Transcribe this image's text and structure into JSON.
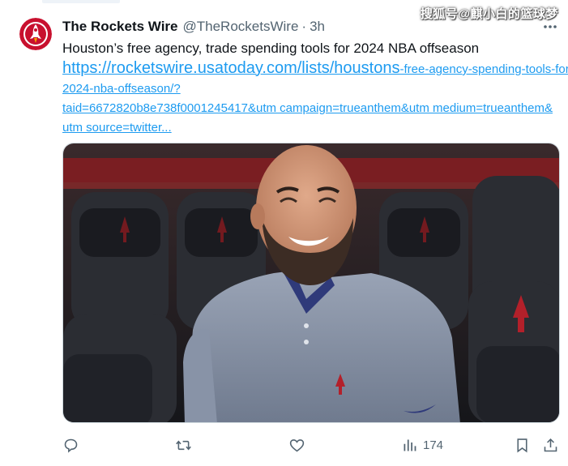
{
  "tweet": {
    "display_name": "The Rockets Wire",
    "handle": "@TheRocketsWire",
    "separator": "·",
    "time": "3h",
    "text": "Houston’s free agency, trade spending tools for 2024 NBA offseason",
    "link_line1_big": "https://rocketswire.usatoday.com/lists/houstons",
    "link_line1_rest": "-free-agency-spending-tools-for-",
    "link_line2": "2024-nba-offseason/?",
    "link_line3": "taid=6672820b8e738f0001245417&utm campaign=trueanthem&utm medium=trueanthem&",
    "link_line4": "utm source=twitter..."
  },
  "watermark": "搜狐号@麒小白的篮球梦",
  "actions": {
    "views_count": "174"
  },
  "icons": {
    "avatar": "rockets-wire-logo-icon",
    "more": "more-dots-icon",
    "reply": "reply-bubble-icon",
    "retweet": "retweet-arrows-icon",
    "like": "heart-icon",
    "views": "bar-chart-icon",
    "bookmark": "bookmark-icon",
    "share": "share-arrow-icon"
  },
  "colors": {
    "link": "#1d9bf0",
    "text": "#0f1419",
    "secondary": "#536471",
    "avatar_red": "#c8102e"
  }
}
